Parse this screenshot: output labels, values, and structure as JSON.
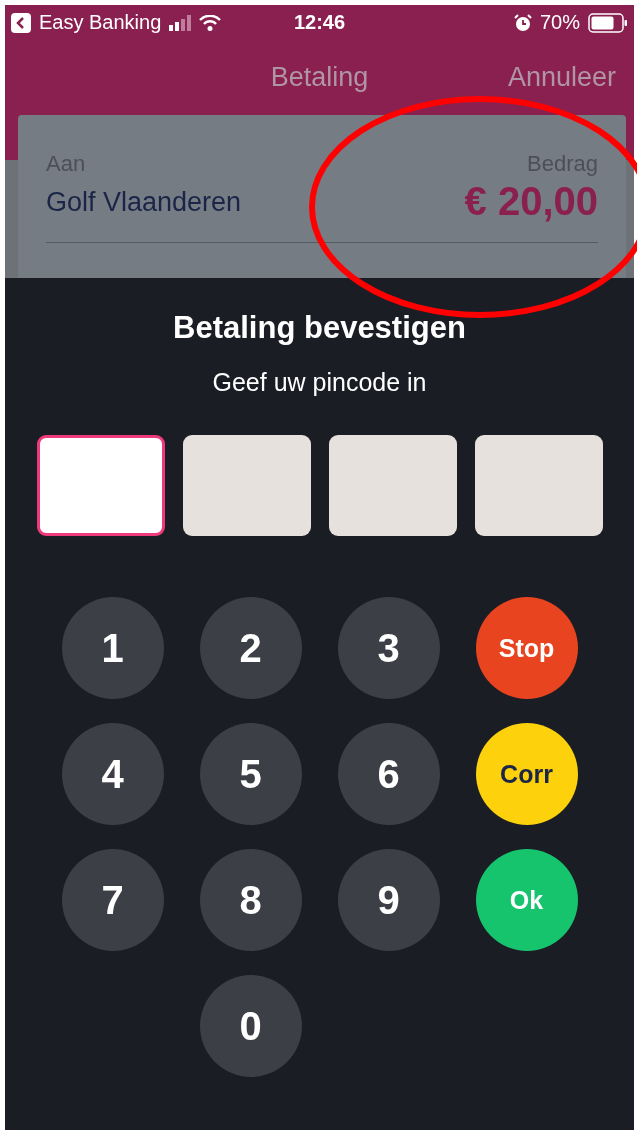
{
  "status_bar": {
    "back_app": "Easy Banking",
    "time": "12:46",
    "battery": "70%"
  },
  "header": {
    "title": "Betaling",
    "cancel": "Annuleer"
  },
  "payment": {
    "to_label": "Aan",
    "to_value": "Golf Vlaanderen",
    "amount_label": "Bedrag",
    "amount": "€ 20,00"
  },
  "dialog": {
    "title": "Betaling bevestigen",
    "prompt": "Geef uw pincode in",
    "pin_boxes": [
      {
        "selected": true
      },
      {
        "selected": false
      },
      {
        "selected": false
      },
      {
        "selected": false
      }
    ],
    "keys": [
      {
        "label": "1",
        "kind": "digit"
      },
      {
        "label": "2",
        "kind": "digit"
      },
      {
        "label": "3",
        "kind": "digit"
      },
      {
        "label": "Stop",
        "kind": "stop"
      },
      {
        "label": "4",
        "kind": "digit"
      },
      {
        "label": "5",
        "kind": "digit"
      },
      {
        "label": "6",
        "kind": "digit"
      },
      {
        "label": "Corr",
        "kind": "corr"
      },
      {
        "label": "7",
        "kind": "digit"
      },
      {
        "label": "8",
        "kind": "digit"
      },
      {
        "label": "9",
        "kind": "digit"
      },
      {
        "label": "Ok",
        "kind": "ok"
      },
      {
        "label": "0",
        "kind": "digit"
      }
    ]
  }
}
